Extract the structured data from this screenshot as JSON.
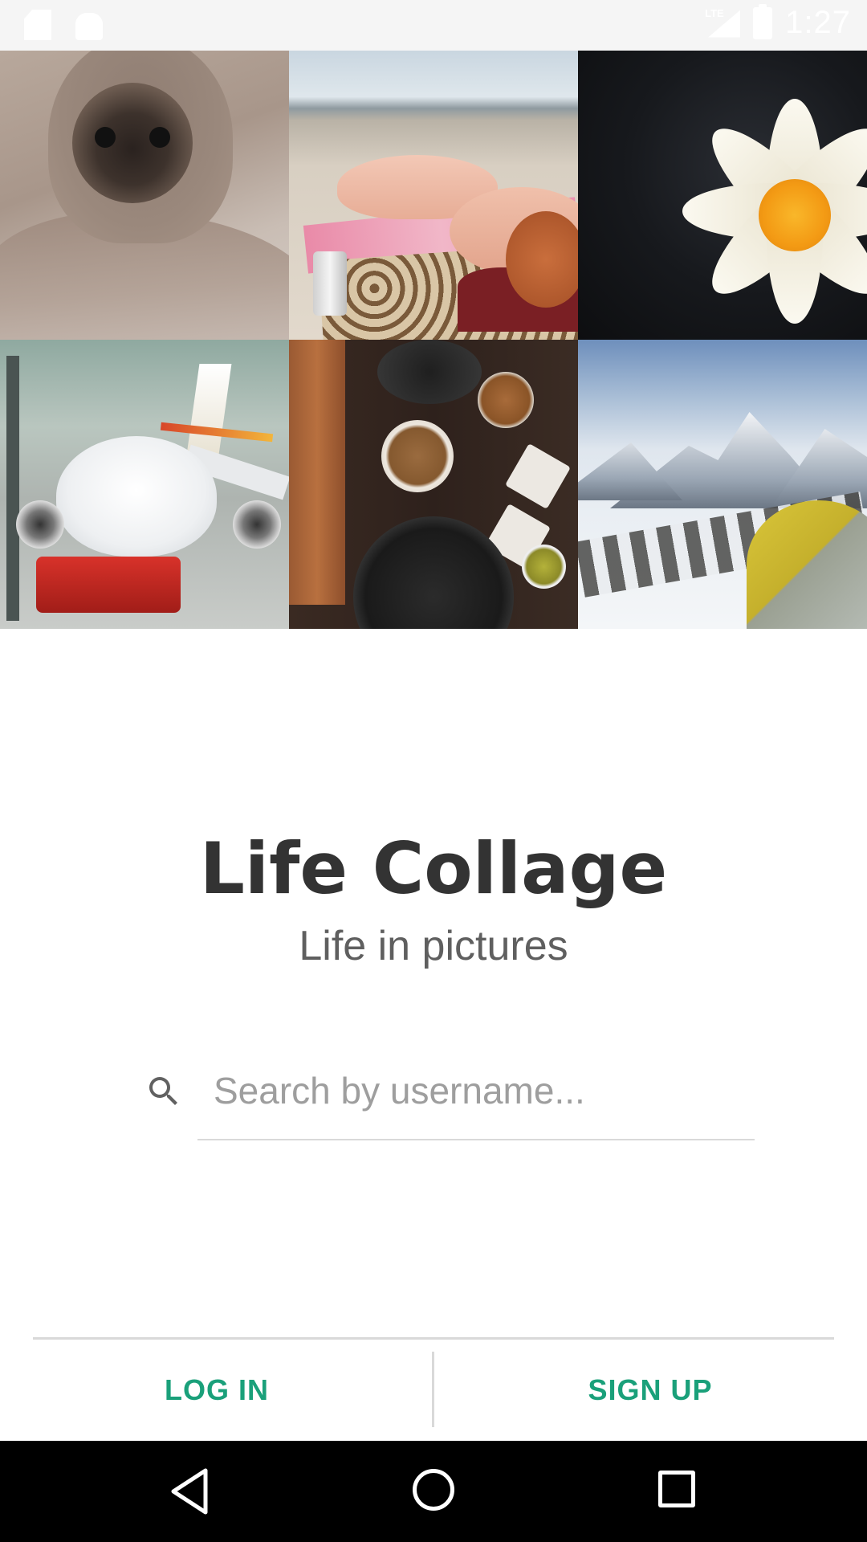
{
  "status_bar": {
    "time": "1:27",
    "network_label": "LTE",
    "icons": [
      "sd-card-icon",
      "android-icon",
      "signal-icon",
      "battery-icon"
    ]
  },
  "collage": {
    "tiles": [
      "pug-blanket",
      "beach-sunbathers",
      "water-lily",
      "airplane-tarmac",
      "spices-table",
      "snowy-mountains-tent"
    ]
  },
  "app": {
    "title": "Life Collage",
    "tagline": "Life in pictures"
  },
  "search": {
    "placeholder": "Search by username...",
    "value": "",
    "icon": "search-icon"
  },
  "actions": {
    "login_label": "LOG IN",
    "signup_label": "SIGN UP",
    "accent_color": "#1aa07a"
  },
  "nav_bar": {
    "icons": [
      "back-icon",
      "home-icon",
      "recents-icon"
    ]
  }
}
